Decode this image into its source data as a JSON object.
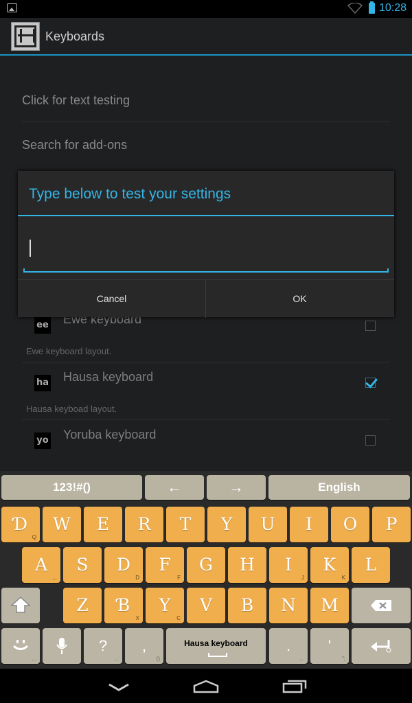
{
  "status_bar": {
    "time": "10:28",
    "icons": [
      "image-icon",
      "wifi-icon",
      "battery-icon"
    ]
  },
  "action_bar": {
    "title": "Keyboards",
    "icon": "app-logo-icon"
  },
  "settings": {
    "items": [
      {
        "label": "Click for text testing"
      },
      {
        "label": "Search for add-ons"
      }
    ],
    "keyboards": [
      {
        "badge": "ee",
        "name": "Ewe keyboard",
        "description": "Ewe keyboard layout.",
        "checked": false
      },
      {
        "badge": "ha",
        "name": "Hausa keyboard",
        "description": "Hausa keyboad layout.",
        "checked": true
      },
      {
        "badge": "yo",
        "name": "Yoruba keyboard",
        "description": "",
        "checked": false
      }
    ]
  },
  "dialog": {
    "title": "Type below to test your settings",
    "input_value": "",
    "cancel_label": "Cancel",
    "ok_label": "OK"
  },
  "keyboard": {
    "top_row": {
      "symbols": "123!#()",
      "left_arrow": "←",
      "right_arrow": "→",
      "language": "English"
    },
    "row1": [
      {
        "main": "Ɗ",
        "sub": "Q"
      },
      {
        "main": "W",
        "sub": ""
      },
      {
        "main": "E",
        "sub": ""
      },
      {
        "main": "R",
        "sub": ""
      },
      {
        "main": "T",
        "sub": ""
      },
      {
        "main": "Y",
        "sub": ""
      },
      {
        "main": "U",
        "sub": ""
      },
      {
        "main": "I",
        "sub": ""
      },
      {
        "main": "O",
        "sub": ""
      },
      {
        "main": "P",
        "sub": ""
      }
    ],
    "row2": [
      {
        "main": "A",
        "sub": "..."
      },
      {
        "main": "S",
        "sub": ""
      },
      {
        "main": "D",
        "sub": "D"
      },
      {
        "main": "F",
        "sub": "F"
      },
      {
        "main": "G",
        "sub": ""
      },
      {
        "main": "H",
        "sub": ""
      },
      {
        "main": "I",
        "sub": "J"
      },
      {
        "main": "K",
        "sub": "K"
      },
      {
        "main": "L",
        "sub": ""
      }
    ],
    "row3": [
      {
        "main": "Z",
        "sub": ""
      },
      {
        "main": "Ɓ",
        "sub": "X"
      },
      {
        "main": "Y",
        "sub": "C"
      },
      {
        "main": "V",
        "sub": ""
      },
      {
        "main": "B",
        "sub": ""
      },
      {
        "main": "N",
        "sub": ""
      },
      {
        "main": "M",
        "sub": ""
      }
    ],
    "row4": {
      "question": "?",
      "comma": ",",
      "comma_sub": "()",
      "space_label": "Hausa keyboard",
      "period": ".",
      "apostrophe": "'",
      "apostrophe_sub": "\";"
    }
  }
}
